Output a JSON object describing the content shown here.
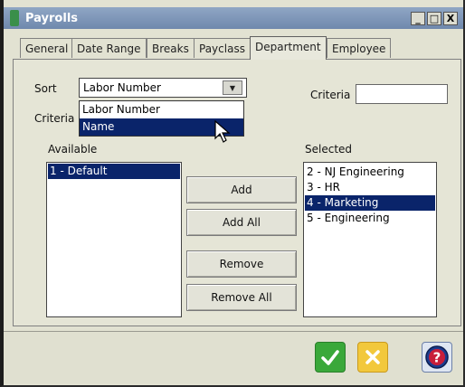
{
  "window": {
    "title": "Payrolls",
    "minimize": "_",
    "maximize": "□",
    "close": "X"
  },
  "tabs": [
    {
      "label": "General"
    },
    {
      "label": "Date Range"
    },
    {
      "label": "Breaks"
    },
    {
      "label": "Payclass"
    },
    {
      "label": "Department",
      "active": true
    },
    {
      "label": "Employee"
    }
  ],
  "sort": {
    "label": "Sort",
    "value": "Labor Number",
    "options": [
      "Labor Number",
      "Name"
    ],
    "highlighted": "Name"
  },
  "criteria_left": {
    "label": "Criteria"
  },
  "criteria_right": {
    "label": "Criteria",
    "value": ""
  },
  "available": {
    "label": "Available",
    "items": [
      "1 - Default"
    ],
    "selected_index": 0
  },
  "selected": {
    "label": "Selected",
    "items": [
      "2 - NJ Engineering",
      "3 - HR",
      "4 - Marketing",
      "5 - Engineering"
    ],
    "selected_index": 2
  },
  "buttons": {
    "add": "Add",
    "add_all": "Add All",
    "remove": "Remove",
    "remove_all": "Remove All"
  },
  "footer": {
    "ok_icon": "checkmark-icon",
    "cancel_icon": "cancel-x-icon",
    "help_icon": "help-question-icon",
    "ok_color": "#3aa83a",
    "cancel_color": "#f2c83c",
    "help_color": "#1b3c8f"
  }
}
